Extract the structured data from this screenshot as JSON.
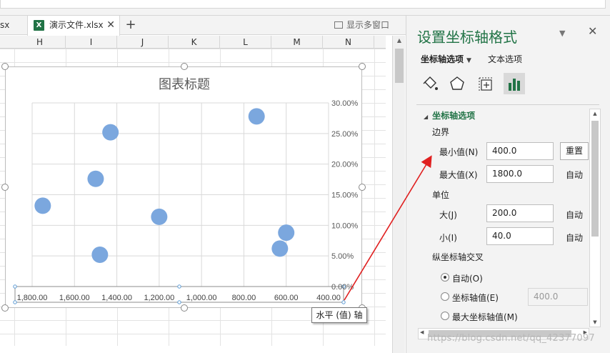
{
  "tabs": {
    "prev_tab_label": "sx",
    "active_tab_icon": "X",
    "active_tab_label": "演示文件.xlsx",
    "close_glyph": "✕",
    "new_tab_glyph": "+",
    "multi_window_label": "显示多窗口"
  },
  "columns": [
    "H",
    "I",
    "J",
    "K",
    "L",
    "M",
    "N"
  ],
  "chart": {
    "title": "图表标题",
    "x_tick_labels": [
      "1,800.00",
      "1,600.00",
      "1,400.00",
      "1,200.00",
      "1,000.00",
      "800.00",
      "600.00",
      "400.00"
    ],
    "y_tick_labels": [
      "30.00%",
      "25.00%",
      "20.00%",
      "15.00%",
      "10.00%",
      "5.00%",
      "0.00%"
    ],
    "tooltip": "水平 (值) 轴"
  },
  "chart_data": {
    "type": "scatter",
    "title": "图表标题",
    "xlabel": "",
    "ylabel": "",
    "x_axis": {
      "min": 400,
      "max": 1800,
      "reversed": true,
      "major_unit": 200
    },
    "y_axis": {
      "min": 0,
      "max": 0.3,
      "position": "right",
      "format": "percent"
    },
    "grid": true,
    "series": [
      {
        "color": "#7BA7DE",
        "points": [
          {
            "x": 1750,
            "y": 0.132
          },
          {
            "x": 1500,
            "y": 0.176
          },
          {
            "x": 1430,
            "y": 0.252
          },
          {
            "x": 1480,
            "y": 0.052
          },
          {
            "x": 1200,
            "y": 0.114
          },
          {
            "x": 740,
            "y": 0.278
          },
          {
            "x": 600,
            "y": 0.088
          },
          {
            "x": 630,
            "y": 0.062
          }
        ]
      }
    ]
  },
  "pane": {
    "title": "设置坐标轴格式",
    "dropdown_glyph": "▼",
    "close_glyph": "✕",
    "tab_axis_options": "坐标轴选项",
    "tab_axis_options_arrow": "▼",
    "tab_text_options": "文本选项",
    "section_title": "坐标轴选项",
    "section_tri": "◢",
    "bounds_label": "边界",
    "min_label": "最小值(N)",
    "min_value": "400.0",
    "reset_button": "重置",
    "max_label": "最大值(X)",
    "max_value": "1800.0",
    "auto_label": "自动",
    "units_label": "单位",
    "major_label": "大(J)",
    "major_value": "200.0",
    "minor_label": "小(I)",
    "minor_value": "40.0",
    "cross_label": "纵坐标轴交叉",
    "radio_auto": "自动(O)",
    "radio_axis_value": "坐标轴值(E)",
    "axis_value_input": "400.0",
    "radio_max": "最大坐标轴值(M)"
  },
  "watermark": "https://blog.csdn.net/qq_42377097",
  "colors": {
    "accent": "#217346",
    "points": "#7BA7DE",
    "arrow": "#E02020"
  }
}
